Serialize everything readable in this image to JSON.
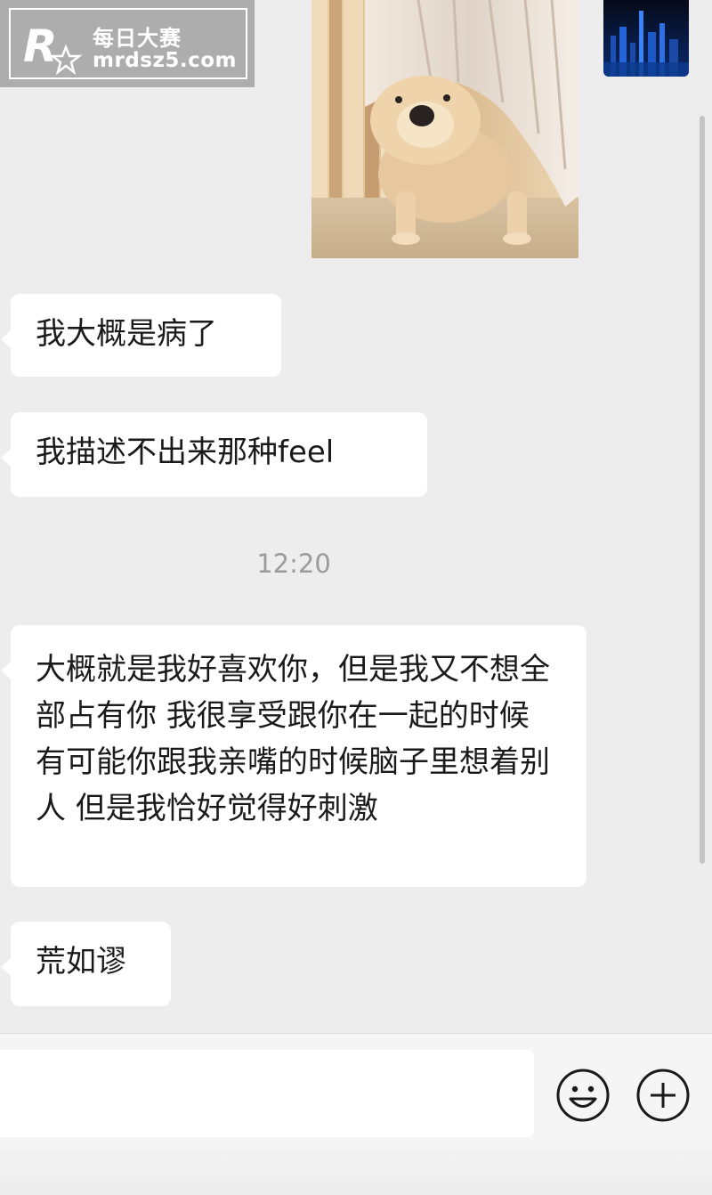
{
  "watermark": {
    "title": "每日大赛",
    "url": "mrdsz5.com",
    "logo_letter": "R"
  },
  "photos": {
    "dog_photo_icon": "dog-peeking-from-curtain",
    "thumb_icon": "city-night-thumbnail"
  },
  "messages": [
    {
      "text": "我大概是病了"
    },
    {
      "text": "我描述不出来那种feel"
    },
    {
      "text": "大概就是我好喜欢你，但是我又不想全部占有你 我很享受跟你在一起的时候 有可能你跟我亲嘴的时候脑子里想着别人 但是我恰好觉得好刺激"
    },
    {
      "text": "荒如谬"
    }
  ],
  "timestamp": "12:20",
  "input": {
    "value": "",
    "placeholder": ""
  },
  "toolbar": {
    "emoji_icon": "smiley-face-icon",
    "plus_icon": "plus-circle-icon"
  },
  "colors": {
    "background": "#ededed",
    "bubble": "#ffffff",
    "text": "#1a1a1a",
    "timestamp": "#9b9b9b"
  }
}
